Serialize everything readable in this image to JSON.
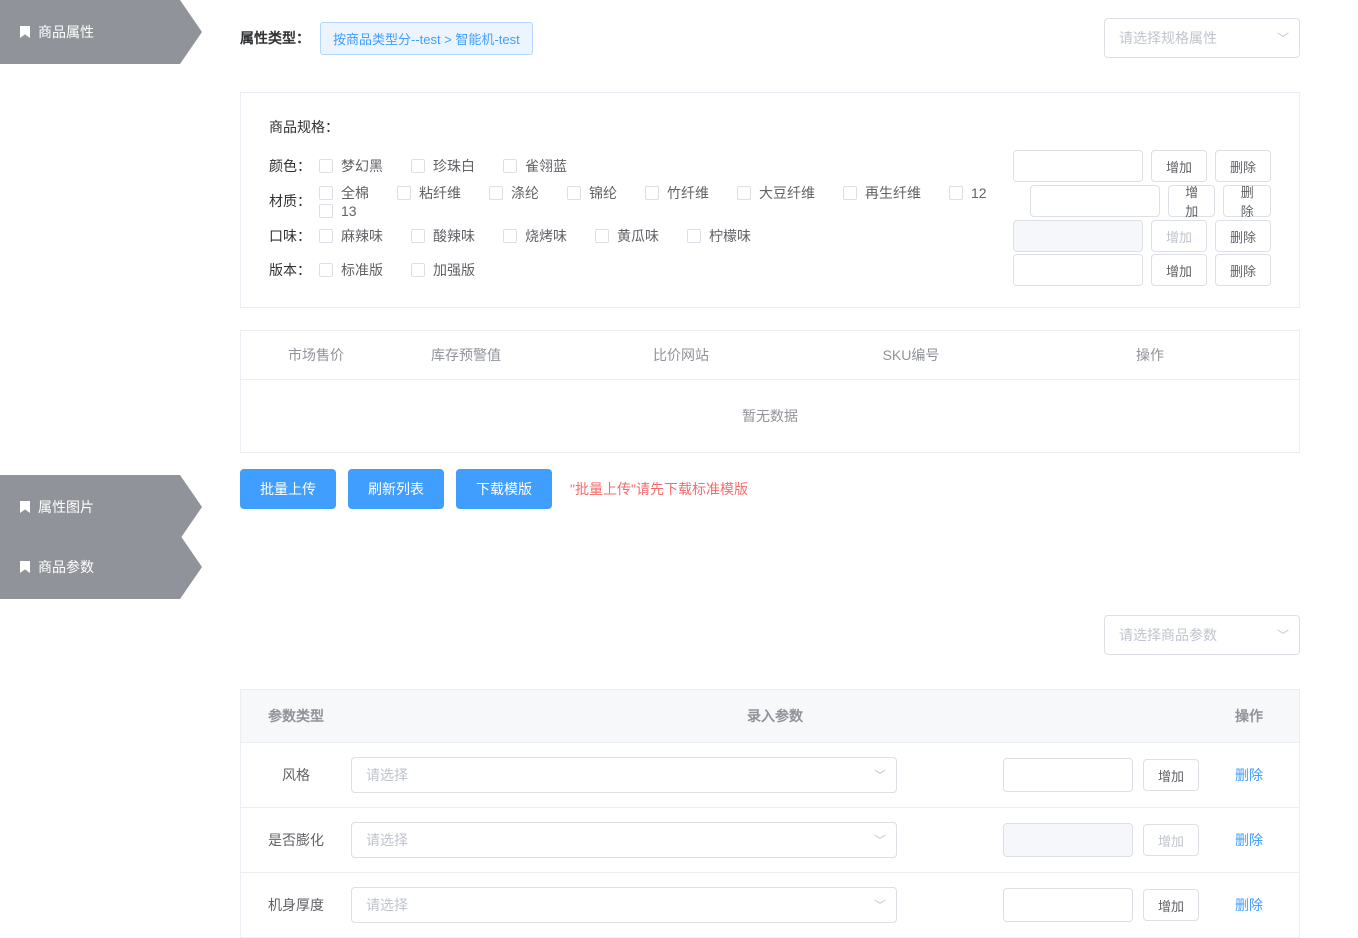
{
  "tabs": {
    "attr": "商品属性",
    "image": "属性图片",
    "params": "商品参数"
  },
  "top": {
    "type_label": "属性类型：",
    "breadcrumb": "按商品类型分--test > 智能机-test",
    "select_spec_placeholder": "请选择规格属性",
    "select_param_placeholder": "请选择商品参数"
  },
  "spec": {
    "title": "商品规格：",
    "btn_add": "增加",
    "btn_del": "删除",
    "rows": [
      {
        "label": "颜色：",
        "options": [
          "梦幻黑",
          "珍珠白",
          "雀翎蓝"
        ],
        "add_disabled": false,
        "input_disabled": false
      },
      {
        "label": "材质：",
        "options": [
          "全棉",
          "粘纤维",
          "涤纶",
          "锦纶",
          "竹纤维",
          "大豆纤维",
          "再生纤维",
          "12",
          "13"
        ],
        "add_disabled": false,
        "input_disabled": false
      },
      {
        "label": "口味：",
        "options": [
          "麻辣味",
          "酸辣味",
          "烧烤味",
          "黄瓜味",
          "柠檬味"
        ],
        "add_disabled": true,
        "input_disabled": true
      },
      {
        "label": "版本：",
        "options": [
          "标准版",
          "加强版"
        ],
        "add_disabled": false,
        "input_disabled": false
      }
    ]
  },
  "sku_table": {
    "headers": [
      "市场售价",
      "库存预警值",
      "比价网站",
      "SKU编号",
      "操作"
    ],
    "empty": "暂无数据"
  },
  "actions": {
    "batch_upload": "批量上传",
    "refresh": "刷新列表",
    "download_tpl": "下载模版",
    "hint": "\"批量上传\"请先下载标准模版"
  },
  "params_table": {
    "headers": [
      "参数类型",
      "录入参数",
      "操作"
    ],
    "select_placeholder": "请选择",
    "btn_add": "增加",
    "del_link": "删除",
    "rows": [
      {
        "type": "风格",
        "add_disabled": false,
        "input_disabled": false
      },
      {
        "type": "是否膨化",
        "add_disabled": true,
        "input_disabled": true
      },
      {
        "type": "机身厚度",
        "add_disabled": false,
        "input_disabled": false
      }
    ]
  }
}
